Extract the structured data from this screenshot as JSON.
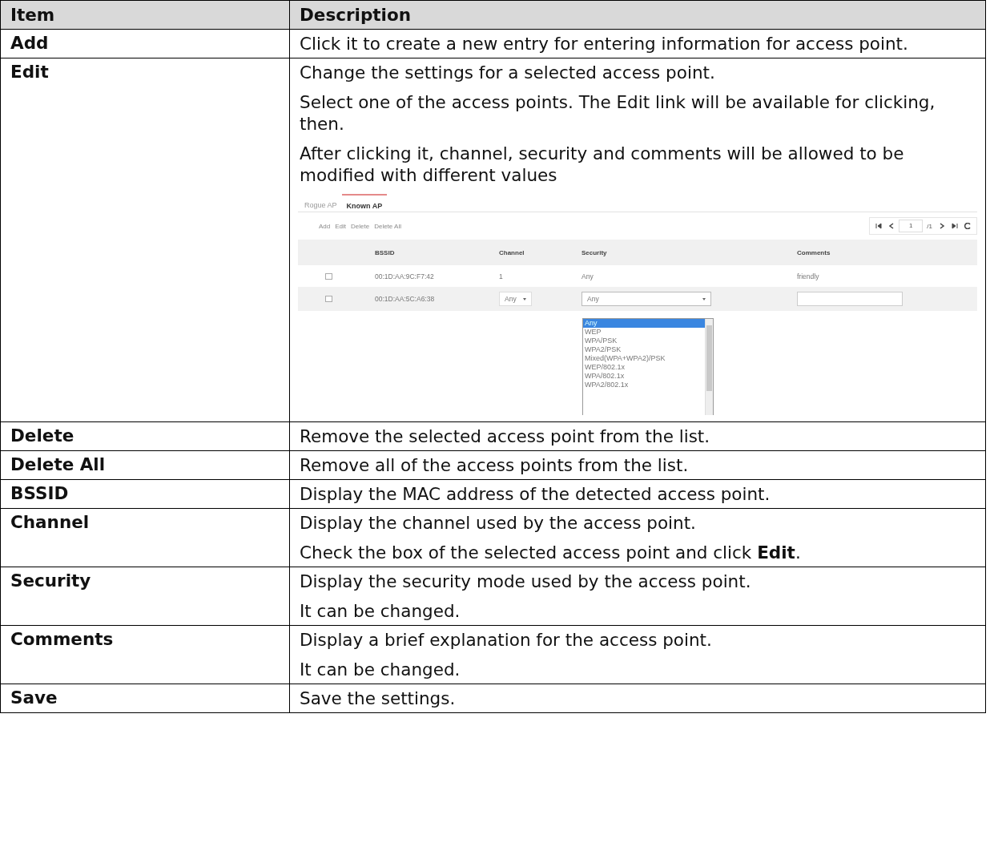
{
  "table": {
    "columns": [
      "Item",
      "Description"
    ],
    "rows": [
      {
        "item": "Add",
        "paragraphs": [
          "Click it to create a new entry for entering information for access point."
        ]
      },
      {
        "item": "Edit",
        "paragraphs": [
          "Change the settings for a selected access point.",
          "Select one of the access points. The Edit link will be available for clicking, then.",
          "After clicking it, channel, security and comments will be allowed to be modified with different values"
        ],
        "screenshot": {
          "tabs": [
            {
              "label": "Rogue AP",
              "selected": false
            },
            {
              "label": "Known AP",
              "selected": true
            }
          ],
          "toolbar": [
            "Add",
            "Edit",
            "Delete",
            "Delete All"
          ],
          "pager": {
            "page": "1",
            "total": "/1"
          },
          "columns": [
            "BSSID",
            "Channel",
            "Security",
            "Comments"
          ],
          "rows": [
            {
              "bssid": "00:1D:AA:9C:F7:42",
              "channel": "1",
              "security": "Any",
              "comments": "friendly",
              "checked": false,
              "editing": false
            },
            {
              "bssid": "00:1D:AA:5C:A6:38",
              "channel": "Any",
              "security": "Any",
              "comments": "",
              "checked": false,
              "editing": true
            }
          ],
          "dropdown": [
            {
              "label": "Any",
              "selected": true
            },
            {
              "label": "WEP",
              "selected": false
            },
            {
              "label": "WPA/PSK",
              "selected": false
            },
            {
              "label": "WPA2/PSK",
              "selected": false
            },
            {
              "label": "Mixed(WPA+WPA2)/PSK",
              "selected": false
            },
            {
              "label": "WEP/802.1x",
              "selected": false
            },
            {
              "label": "WPA/802.1x",
              "selected": false
            },
            {
              "label": "WPA2/802.1x",
              "selected": false
            }
          ]
        }
      },
      {
        "item": "Delete",
        "paragraphs": [
          "Remove the selected access point from the list."
        ]
      },
      {
        "item": "Delete All",
        "paragraphs": [
          "Remove all of the access points from the list."
        ]
      },
      {
        "item": "BSSID",
        "paragraphs": [
          "Display the MAC address of the detected access point."
        ]
      },
      {
        "item": "Channel",
        "paragraphs": [
          "Display the channel used by the access point.",
          "Check the box of the selected access point and click **Edit**."
        ]
      },
      {
        "item": "Security",
        "paragraphs": [
          "Display the security mode used by the access point.",
          "It can be changed."
        ]
      },
      {
        "item": "Comments",
        "paragraphs": [
          "Display a brief explanation for the access point.",
          "It can be changed."
        ]
      },
      {
        "item": "Save",
        "paragraphs": [
          "Save the settings."
        ]
      }
    ]
  }
}
